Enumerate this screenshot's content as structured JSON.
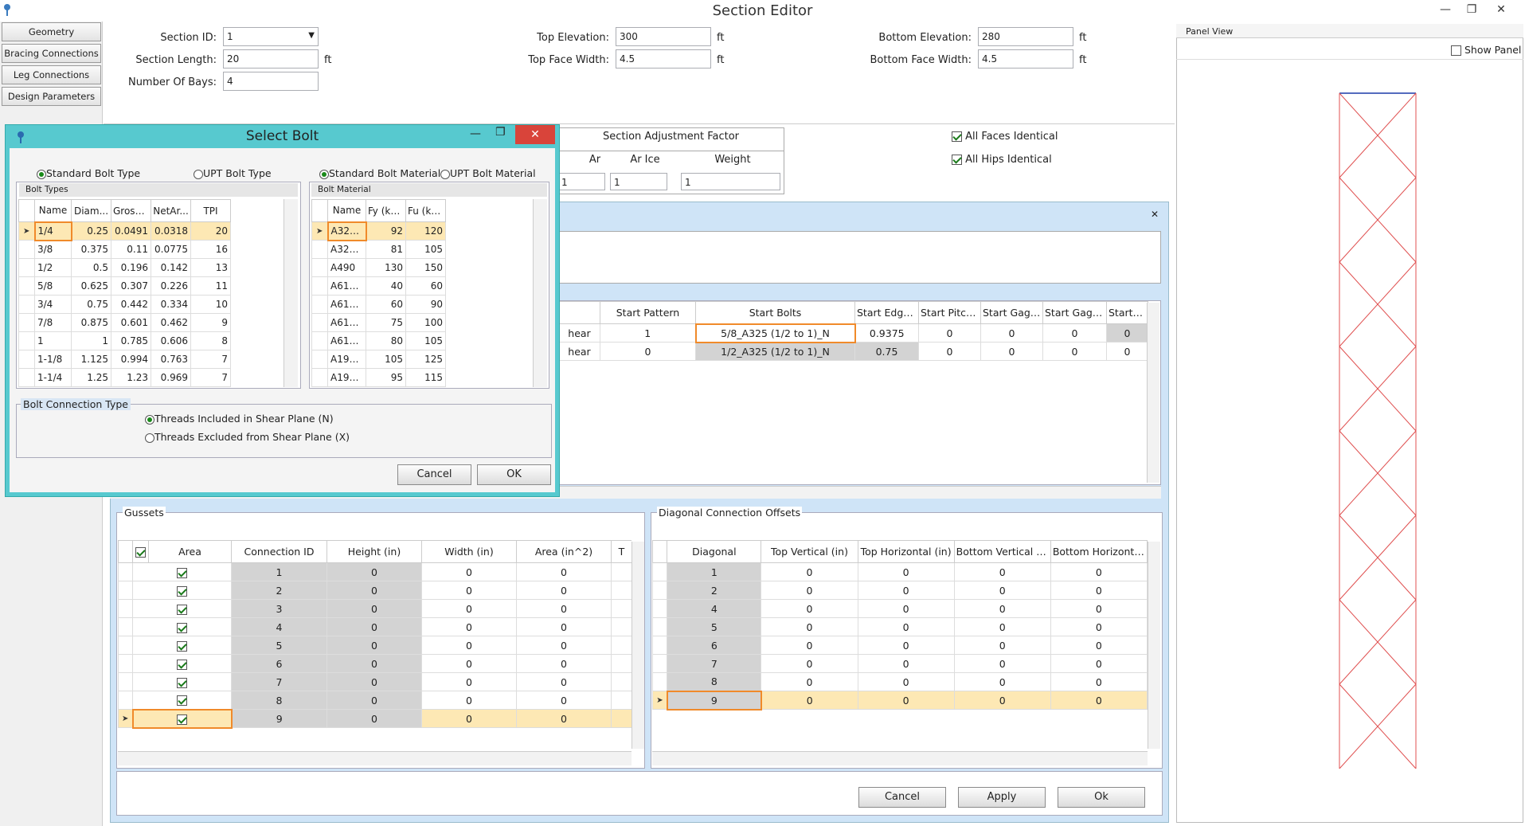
{
  "window": {
    "title": "Section Editor",
    "min": "—",
    "max": "❐",
    "close": "✕"
  },
  "nav": [
    "Geometry",
    "Bracing Connections",
    "Leg Connections",
    "Design Parameters"
  ],
  "fields": {
    "section_id": {
      "label": "Section ID:",
      "value": "1"
    },
    "section_length": {
      "label": "Section Length:",
      "value": "20",
      "unit": "ft"
    },
    "number_of_bays": {
      "label": "Number Of Bays:",
      "value": "4"
    },
    "top_elevation": {
      "label": "Top Elevation:",
      "value": "300",
      "unit": "ft"
    },
    "top_face_width": {
      "label": "Top Face Width:",
      "value": "4.5",
      "unit": "ft"
    },
    "bottom_elevation": {
      "label": "Bottom Elevation:",
      "value": "280",
      "unit": "ft"
    },
    "bottom_face_width": {
      "label": "Bottom Face Width:",
      "value": "4.5",
      "unit": "ft"
    }
  },
  "adjustment": {
    "title": "Section Adjustment Factor",
    "cols": [
      "Ar",
      "Ar Ice",
      "Weight"
    ],
    "values": [
      "1",
      "1",
      "1"
    ]
  },
  "checks": {
    "all_faces": "All Faces Identical",
    "all_hips": "All Hips Identical"
  },
  "panel_view": {
    "title": "Panel View",
    "show_panel": "Show Panel"
  },
  "bracing_grid": {
    "headers": [
      "Start Pattern",
      "Start Bolts",
      "Start Edge...",
      "Start Pitch...",
      "Start Gage...",
      "Start Gage...",
      "Start Gu"
    ],
    "rows": [
      {
        "lead": "hear",
        "cells": [
          "1",
          "5/8_A325 (1/2 to 1)_N",
          "0.9375",
          "0",
          "0",
          "0",
          "0"
        ]
      },
      {
        "lead": "hear",
        "cells": [
          "0",
          "1/2_A325 (1/2 to 1)_N",
          "0.75",
          "0",
          "0",
          "0",
          "0"
        ]
      }
    ]
  },
  "gussets": {
    "title": "Gussets",
    "headers": [
      "Area",
      "Connection ID",
      "Height (in)",
      "Width (in)",
      "Area (in^2)",
      "T"
    ],
    "rows": [
      [
        "1",
        "0",
        "0",
        "0"
      ],
      [
        "2",
        "0",
        "0",
        "0"
      ],
      [
        "3",
        "0",
        "0",
        "0"
      ],
      [
        "4",
        "0",
        "0",
        "0"
      ],
      [
        "5",
        "0",
        "0",
        "0"
      ],
      [
        "6",
        "0",
        "0",
        "0"
      ],
      [
        "7",
        "0",
        "0",
        "0"
      ],
      [
        "8",
        "0",
        "0",
        "0"
      ],
      [
        "9",
        "0",
        "0",
        "0"
      ]
    ]
  },
  "offsets": {
    "title": "Diagonal Connection Offsets",
    "headers": [
      "Diagonal",
      "Top Vertical (in)",
      "Top Horizontal (in)",
      "Bottom Vertical (in)",
      "Bottom Horizonta..."
    ],
    "rows": [
      [
        "1",
        "0",
        "0",
        "0",
        "0"
      ],
      [
        "2",
        "0",
        "0",
        "0",
        "0"
      ],
      [
        "4",
        "0",
        "0",
        "0",
        "0"
      ],
      [
        "5",
        "0",
        "0",
        "0",
        "0"
      ],
      [
        "6",
        "0",
        "0",
        "0",
        "0"
      ],
      [
        "7",
        "0",
        "0",
        "0",
        "0"
      ],
      [
        "8",
        "0",
        "0",
        "0",
        "0"
      ],
      [
        "9",
        "0",
        "0",
        "0",
        "0"
      ]
    ]
  },
  "main_buttons": {
    "cancel": "Cancel",
    "apply": "Apply",
    "ok": "Ok"
  },
  "dialog": {
    "title": "Select Bolt",
    "std_bolt_type": "Standard Bolt Type",
    "upt_bolt_type": "UPT Bolt Type",
    "std_bolt_material": "Standard Bolt Material",
    "upt_bolt_material": "UPT Bolt Material",
    "bolt_types_title": "Bolt Types",
    "bolt_types_headers": [
      "Name",
      "Diam...",
      "Gross...",
      "NetAr...",
      "TPI"
    ],
    "bolt_types": [
      [
        "1/4",
        "0.25",
        "0.0491",
        "0.0318",
        "20"
      ],
      [
        "3/8",
        "0.375",
        "0.11",
        "0.0775",
        "16"
      ],
      [
        "1/2",
        "0.5",
        "0.196",
        "0.142",
        "13"
      ],
      [
        "5/8",
        "0.625",
        "0.307",
        "0.226",
        "11"
      ],
      [
        "3/4",
        "0.75",
        "0.442",
        "0.334",
        "10"
      ],
      [
        "7/8",
        "0.875",
        "0.601",
        "0.462",
        "9"
      ],
      [
        "1",
        "1",
        "0.785",
        "0.606",
        "8"
      ],
      [
        "1-1/8",
        "1.125",
        "0.994",
        "0.763",
        "7"
      ],
      [
        "1-1/4",
        "1.25",
        "1.23",
        "0.969",
        "7"
      ]
    ],
    "bolt_material_title": "Bolt Material",
    "bolt_material_headers": [
      "Name",
      "Fy (ksi )",
      "Fu (ksi )"
    ],
    "bolt_material": [
      [
        "A325...",
        "92",
        "120"
      ],
      [
        "A325...",
        "81",
        "105"
      ],
      [
        "A490",
        "130",
        "150"
      ],
      [
        "A615...",
        "40",
        "60"
      ],
      [
        "A615...",
        "60",
        "90"
      ],
      [
        "A615...",
        "75",
        "100"
      ],
      [
        "A615...",
        "80",
        "105"
      ],
      [
        "A193...",
        "105",
        "125"
      ],
      [
        "A193...",
        "95",
        "115"
      ]
    ],
    "conn_type_title": "Bolt Connection Type",
    "threads_included": "Threads Included in Shear Plane (N)",
    "threads_excluded": "Threads Excluded from Shear Plane (X)",
    "cancel": "Cancel",
    "ok": "OK"
  },
  "colors": {
    "dialog_frame": "#57c9cf",
    "close_red": "#d9443a",
    "selection": "#fde8b4",
    "brace_line": "#e05050"
  }
}
